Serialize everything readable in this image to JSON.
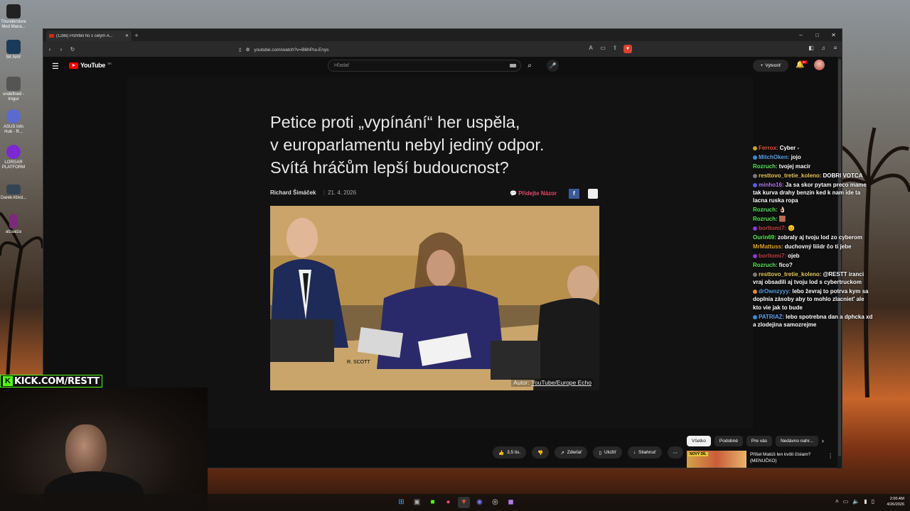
{
  "desktop": {
    "icons": [
      {
        "label": "Thunderstore Mod Mana...",
        "color": "#222222"
      },
      {
        "label": "SK NAY",
        "color": "#1a3a5a"
      },
      {
        "label": "undefined - Imgur",
        "color": "#555555"
      },
      {
        "label": "ASUS Info Hub - R...",
        "color": "#5a6ad0"
      },
      {
        "label": "LORGAR PLATFORM",
        "color": "#7a2ad0"
      },
      {
        "label": "Darek-Klivd...",
        "color": "#334455"
      },
      {
        "label": "alzaaiza",
        "color": "#7a2a7a"
      }
    ]
  },
  "browser": {
    "tab_title": "(1288) Pohřbili ho s celým A...",
    "url": "youtube.com/watch?v=B6hPra-Enys",
    "new_tab": "+",
    "controls": {
      "minimize": "–",
      "maximize": "□",
      "close": "✕"
    }
  },
  "youtube": {
    "logo": "YouTube",
    "region": "SK",
    "search_placeholder": "Hľadať",
    "create_label": "Vytvoriť",
    "notif_count": "9+",
    "colors": {
      "brand": "#ff0000",
      "opinion": "#e24a6d",
      "kick": "#53fc18"
    }
  },
  "article": {
    "title_line1": "Petice proti „vypínání“ her uspěla,",
    "title_line2": "v europarlamentu nebyl jediný odpor.",
    "title_line3": "Svítá hráčům lepší budoucnost?",
    "author": "Richard Šimáček",
    "separator": "|",
    "date": "21. 4. 2026",
    "opinion_label": "Přidejte Názor",
    "facebook_icon": "f",
    "credit_prefix": "Autor:",
    "credit_link": "YouTube/Europe Echo",
    "photo_label": "R. SCOTT"
  },
  "actions": {
    "likes": "3,5 tis.",
    "share": "Zdieľať",
    "save": "Uložiť",
    "download": "Stiahnuť"
  },
  "chips": [
    "Všetko",
    "Podobné",
    "Pre vás",
    "Nedávno nahr..."
  ],
  "recommendation": {
    "badge": "NOVÝ DÍL",
    "title": "Přišel Matúš len kvôli číslam?",
    "channel": "(MENUČKO)"
  },
  "chat": [
    {
      "user": "Ferrox:",
      "text": "Cyber -",
      "color": "#e05a3a",
      "badge": "#d0a030"
    },
    {
      "user": "MitchOken:",
      "text": "jojo",
      "color": "#5aa0e8",
      "badge": "#3a8ad0"
    },
    {
      "user": "Rozruch:",
      "text": "tvojej macir",
      "color": "#5ae85a",
      "badge": ""
    },
    {
      "user": "resttovo_tretie_koleno:",
      "text": "DOBRI VOTCA",
      "color": "#e8c85a",
      "badge": "#7a7a7a"
    },
    {
      "user": "minho16:",
      "text": "Ja sa skor pytam preco mame tak kurva drahy benzin ked k nam ide ta lacna ruska ropa",
      "color": "#b07ae8",
      "badge": "#5a5ae8"
    },
    {
      "user": "Rozruch:",
      "text": "👌🏻",
      "color": "#5ae85a",
      "badge": ""
    },
    {
      "user": "Rozruch:",
      "text": "🟫",
      "color": "#5ae85a",
      "badge": ""
    },
    {
      "user": "borltomi7:",
      "text": "😊",
      "color": "#c04040",
      "badge": "#8a3ad0"
    },
    {
      "user": "Ourin69:",
      "text": "zobraly aj tvoju lod zo cyberom",
      "color": "#5ae85a",
      "badge": ""
    },
    {
      "user": "MrMattuss:",
      "text": "duchovný liiidr čo ti jebe",
      "color": "#e8a030",
      "badge": ""
    },
    {
      "user": "borltomi7:",
      "text": "ojeb",
      "color": "#c04040",
      "badge": "#8a3ad0"
    },
    {
      "user": "Rozruch:",
      "text": "fico?",
      "color": "#5ae85a",
      "badge": ""
    },
    {
      "user": "resttovo_tretie_koleno:",
      "text": "@RESTT iranci vraj obsadili aj tvoju lod s cybertruckom",
      "color": "#e8c85a",
      "badge": "#7a7a7a"
    },
    {
      "user": "drOwnzyyy:",
      "text": "lebo ževraj to potrva kym sa doplnia zásoby aby to mohlo zlacniet' ale kto vie jak to bude",
      "color": "#5aa0e8",
      "badge": "#e08a3a"
    },
    {
      "user": "PATRIAZ:",
      "text": "lebo spotrebna dan a dphcka xd a zlodejina samozrejme",
      "color": "#5aa0e8",
      "badge": "#3a8ad0"
    }
  ],
  "stream": {
    "kick_label": "KICK.COM/RESTT",
    "kick_icon": "K"
  },
  "taskbar": {
    "time": "2:00 AM",
    "date": "4/26/2026"
  }
}
